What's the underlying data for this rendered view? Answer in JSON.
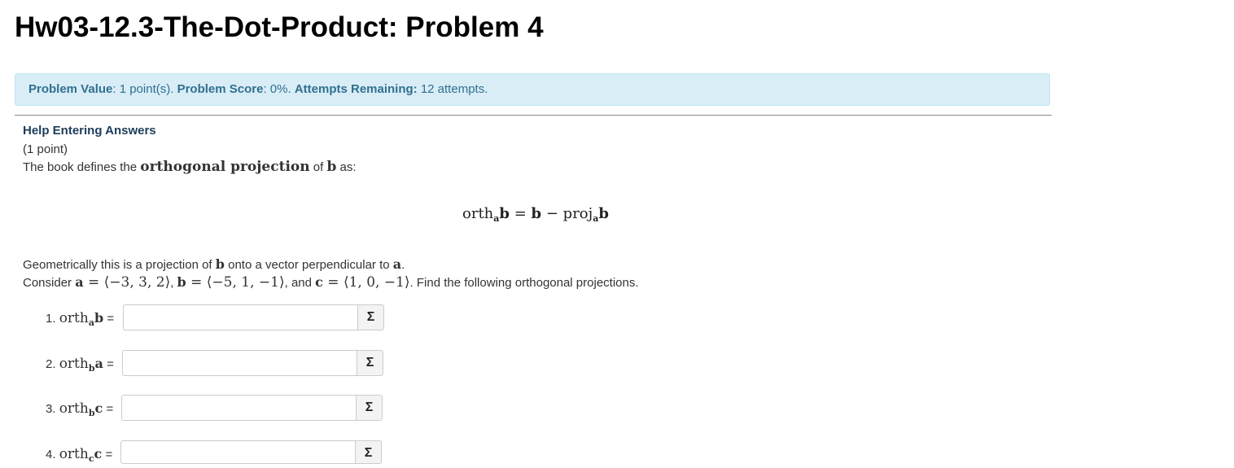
{
  "page": {
    "title": "Hw03-12.3-The-Dot-Product: Problem 4"
  },
  "score_banner": {
    "value_label": "Problem Value",
    "value_text": ": 1 point(s). ",
    "score_label": "Problem Score",
    "score_text": ": 0%. ",
    "attempts_label": "Attempts Remaining:",
    "attempts_text": " 12 attempts.",
    "bg_color": "#d9edf7",
    "text_color": "#31708f"
  },
  "problem": {
    "help_link": "Help Entering Answers",
    "points": "(1 point)",
    "intro_prefix": "The book defines the ",
    "intro_term": "orthogonal projection",
    "intro_mid": " of ",
    "intro_vec": "b",
    "intro_suffix": " as:",
    "display_equation": {
      "lhs_op": "orth",
      "lhs_sub": "a",
      "lhs_vec": "b",
      "eq": " = ",
      "rhs_vec": "b",
      "minus": " − ",
      "rhs_op": "proj",
      "rhs_sub": "a",
      "rhs_vec2": "b"
    },
    "geo_prefix": "Geometrically this is a projection of ",
    "geo_vec1": "b",
    "geo_mid": " onto a vector perpendicular to ",
    "geo_vec2": "a",
    "geo_suffix": ".",
    "consider_prefix": "Consider ",
    "vec_a_name": "a",
    "vec_a_value": " = ⟨−3, 3, 2⟩",
    "sep1": ", ",
    "vec_b_name": "b",
    "vec_b_value": " = ⟨−5, 1, −1⟩",
    "sep2": ", and ",
    "vec_c_name": "c",
    "vec_c_value": " = ⟨1, 0, −1⟩",
    "consider_suffix": ". Find the following orthogonal projections."
  },
  "answers": [
    {
      "number": "1. ",
      "op": "orth",
      "sub": "a",
      "vec": "b",
      "eq": " =",
      "value": "",
      "button_label": "Σ"
    },
    {
      "number": "2. ",
      "op": "orth",
      "sub": "b",
      "vec": "a",
      "eq": " =",
      "value": "",
      "button_label": "Σ"
    },
    {
      "number": "3. ",
      "op": "orth",
      "sub": "b",
      "vec": "c",
      "eq": " =",
      "value": "",
      "button_label": "Σ"
    },
    {
      "number": "4. ",
      "op": "orth",
      "sub": "c",
      "vec": "c",
      "eq": " =",
      "value": "",
      "button_label": "Σ"
    }
  ]
}
